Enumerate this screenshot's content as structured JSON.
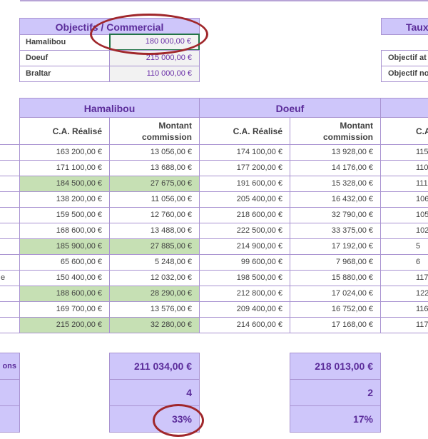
{
  "objectives": {
    "title": "Objectifs / Commercial",
    "rows": [
      {
        "name": "Hamalibou",
        "value": "180 000,00 €"
      },
      {
        "name": "Doeuf",
        "value": "215 000,00 €"
      },
      {
        "name": "Braltar",
        "value": "110 000,00 €"
      }
    ]
  },
  "taux": {
    "title": "Taux",
    "label_1": "Objectif at",
    "label_2": "Objectif no"
  },
  "sales": {
    "headers": [
      "Hamalibou",
      "Doeuf"
    ],
    "col_ca": "C.A. Réalisé",
    "col_commission": [
      "Montant",
      "commission"
    ],
    "col_partial": "C.A",
    "rows": [
      {
        "h_ca": "163 200,00 €",
        "h_com": "13 056,00 €",
        "d_ca": "174 100,00 €",
        "d_com": "13 928,00 €",
        "edge": "115",
        "green": false
      },
      {
        "h_ca": "171 100,00 €",
        "h_com": "13 688,00 €",
        "d_ca": "177 200,00 €",
        "d_com": "14 176,00 €",
        "edge": "110",
        "green": false
      },
      {
        "h_ca": "184 500,00 €",
        "h_com": "27 675,00 €",
        "d_ca": "191 600,00 €",
        "d_com": "15 328,00 €",
        "edge": "111",
        "green": true
      },
      {
        "h_ca": "138 200,00 €",
        "h_com": "11 056,00 €",
        "d_ca": "205 400,00 €",
        "d_com": "16 432,00 €",
        "edge": "106",
        "green": false
      },
      {
        "h_ca": "159 500,00 €",
        "h_com": "12 760,00 €",
        "d_ca": "218 600,00 €",
        "d_com": "32 790,00 €",
        "edge": "105",
        "green": false
      },
      {
        "h_ca": "168 600,00 €",
        "h_com": "13 488,00 €",
        "d_ca": "222 500,00 €",
        "d_com": "33 375,00 €",
        "edge": "102",
        "green": false
      },
      {
        "h_ca": "185 900,00 €",
        "h_com": "27 885,00 €",
        "d_ca": "214 900,00 €",
        "d_com": "17 192,00 €",
        "edge": "5",
        "green": true
      },
      {
        "h_ca": "65 600,00 €",
        "h_com": "5 248,00 €",
        "d_ca": "99 600,00 €",
        "d_com": "7 968,00 €",
        "edge": "6",
        "green": false
      },
      {
        "h_ca": "150 400,00 €",
        "h_com": "12 032,00 €",
        "d_ca": "198 500,00 €",
        "d_com": "15 880,00 €",
        "edge": "117",
        "green": false
      },
      {
        "h_ca": "188 600,00 €",
        "h_com": "28 290,00 €",
        "d_ca": "212 800,00 €",
        "d_com": "17 024,00 €",
        "edge": "122",
        "green": true
      },
      {
        "h_ca": "169 700,00 €",
        "h_com": "13 576,00 €",
        "d_ca": "209 400,00 €",
        "d_com": "16 752,00 €",
        "edge": "116",
        "green": false
      },
      {
        "h_ca": "215 200,00 €",
        "h_com": "32 280,00 €",
        "d_ca": "214 600,00 €",
        "d_com": "17 168,00 €",
        "edge": "117",
        "green": true
      }
    ],
    "left_edge_row9": "e"
  },
  "summary": {
    "label_partial": "ons",
    "h_total": "211 034,00 €",
    "h_count": "4",
    "h_pct": "33%",
    "d_total": "218 013,00 €",
    "d_count": "2",
    "d_pct": "17%"
  },
  "colors": {
    "header_bg": "#cec6fa",
    "header_text": "#5b2c9a",
    "green": "#c6e0b4",
    "annotation": "#a0272b"
  }
}
